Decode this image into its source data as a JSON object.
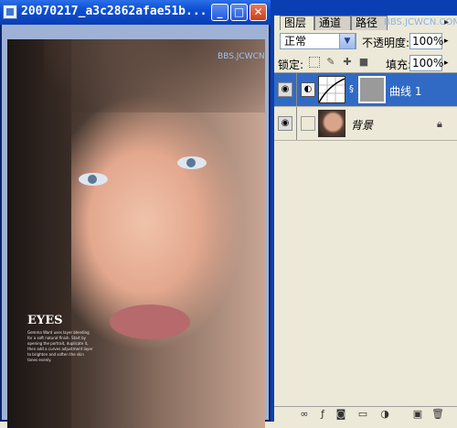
{
  "document": {
    "title": "20070217_a3c2862afae51b...",
    "buttons": {
      "minimize": "_",
      "maximize": "□",
      "close": "✕"
    },
    "photo": {
      "watermark": "BBS.JCWCN.COM",
      "heading": "EYES",
      "text": "Gemma Ward uses layer blending for a soft natural finish. Start by opening the portrait, duplicate it, then add a curves adjustment layer to brighten and soften the skin tones evenly."
    }
  },
  "palette": {
    "tabs": [
      "图层",
      "通道",
      "路径"
    ],
    "watermark": "BBS.JCWCN.COM",
    "menu_arrow": "▸",
    "blend_mode": "正常",
    "blend_arrow": "▼",
    "opacity_label": "不透明度:",
    "opacity_value": "100%",
    "lock_label": "锁定:",
    "fill_label": "填充:",
    "fill_value": "100%",
    "layers": [
      {
        "name": "曲线 1",
        "selected": true
      },
      {
        "name": "背景",
        "locked": true
      }
    ]
  },
  "icons": {
    "eye": "eye-icon",
    "lock": "lock-icon",
    "link": "link-icon",
    "new_layer": "new-layer-icon",
    "trash": "trash-icon"
  },
  "colors": {
    "title_bar": "#0d4ed3",
    "selected_layer": "#316ac5",
    "panel_bg": "#ece9d8"
  }
}
